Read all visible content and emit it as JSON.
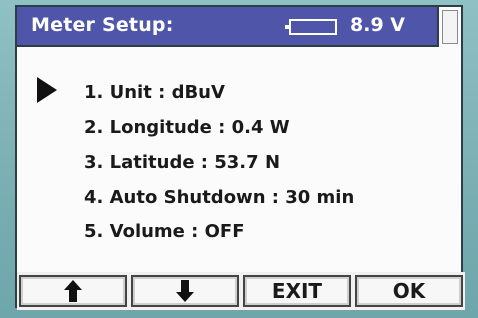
{
  "header": {
    "title": "Meter Setup:",
    "battery_icon": "battery-icon",
    "voltage": "8.9 V"
  },
  "menu": {
    "selected_index": 0,
    "items": [
      {
        "label": "1. Unit : dBuV"
      },
      {
        "label": "2. Longitude : 0.4 W"
      },
      {
        "label": "3. Latitude :  53.7 N"
      },
      {
        "label": "4. Auto Shutdown : 30 min"
      },
      {
        "label": "5. Volume : OFF"
      }
    ]
  },
  "buttons": {
    "up_icon": "arrow-up-icon",
    "down_icon": "arrow-down-icon",
    "exit_label": "EXIT",
    "ok_label": "OK"
  },
  "colors": {
    "header_bg": "#4f55a8",
    "device_bg": "#7fb3b7",
    "screen_bg": "#fbfbfb"
  }
}
